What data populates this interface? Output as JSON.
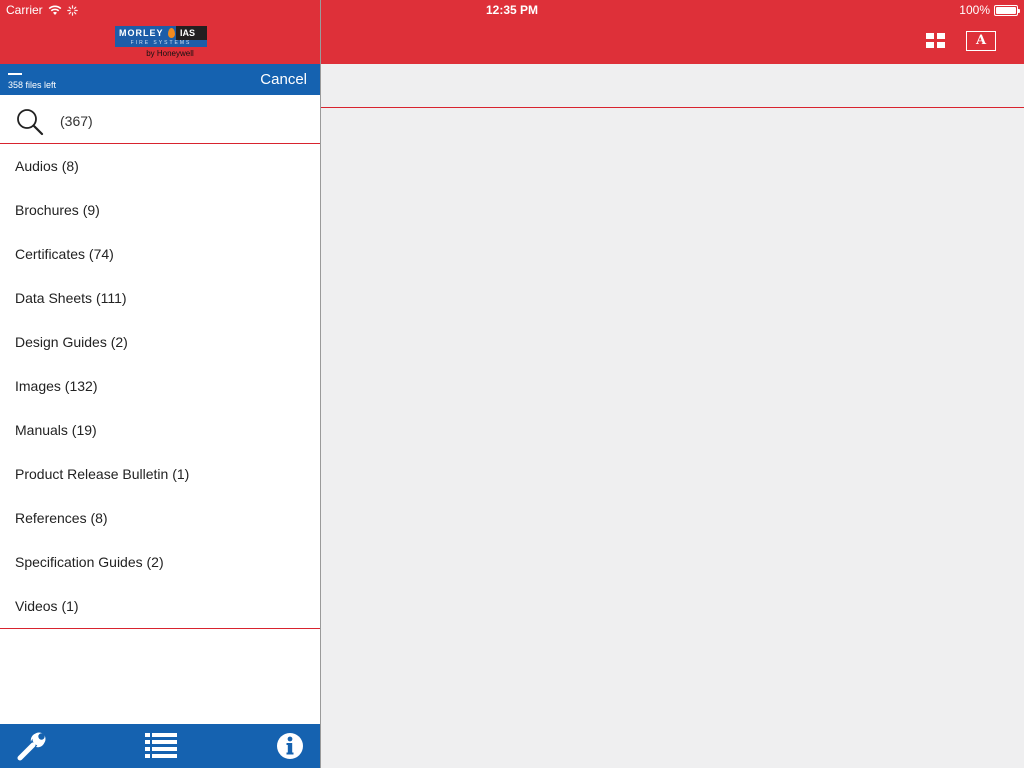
{
  "status_bar": {
    "carrier": "Carrier",
    "time": "12:35 PM",
    "battery": "100%",
    "battery_level": 1.0
  },
  "header": {
    "logo": {
      "brand": "MORLEY",
      "brand2": "IAS",
      "tagline": "FIRE SYSTEMS",
      "byline": "by Honeywell"
    },
    "grid_icon": "grid-icon",
    "font_icon_glyph": "A"
  },
  "progress": {
    "files_left": "358 files left",
    "cancel_label": "Cancel"
  },
  "search": {
    "value": "",
    "placeholder": "(367)"
  },
  "categories": [
    {
      "label": "Audios (8)"
    },
    {
      "label": "Brochures (9)"
    },
    {
      "label": "Certificates (74)"
    },
    {
      "label": "Data Sheets (111)"
    },
    {
      "label": "Design Guides (2)"
    },
    {
      "label": "Images (132)"
    },
    {
      "label": "Manuals (19)"
    },
    {
      "label": "Product Release Bulletin (1)"
    },
    {
      "label": "References (8)"
    },
    {
      "label": "Specification Guides (2)"
    },
    {
      "label": "Videos (1)"
    }
  ],
  "toolbar": {
    "icons": [
      "wrench-icon",
      "list-icon",
      "info-icon"
    ]
  },
  "colors": {
    "header_red": "#de3039",
    "accent_blue": "#1562b0",
    "divider_red": "#d8232e",
    "background": "#efeff0"
  }
}
